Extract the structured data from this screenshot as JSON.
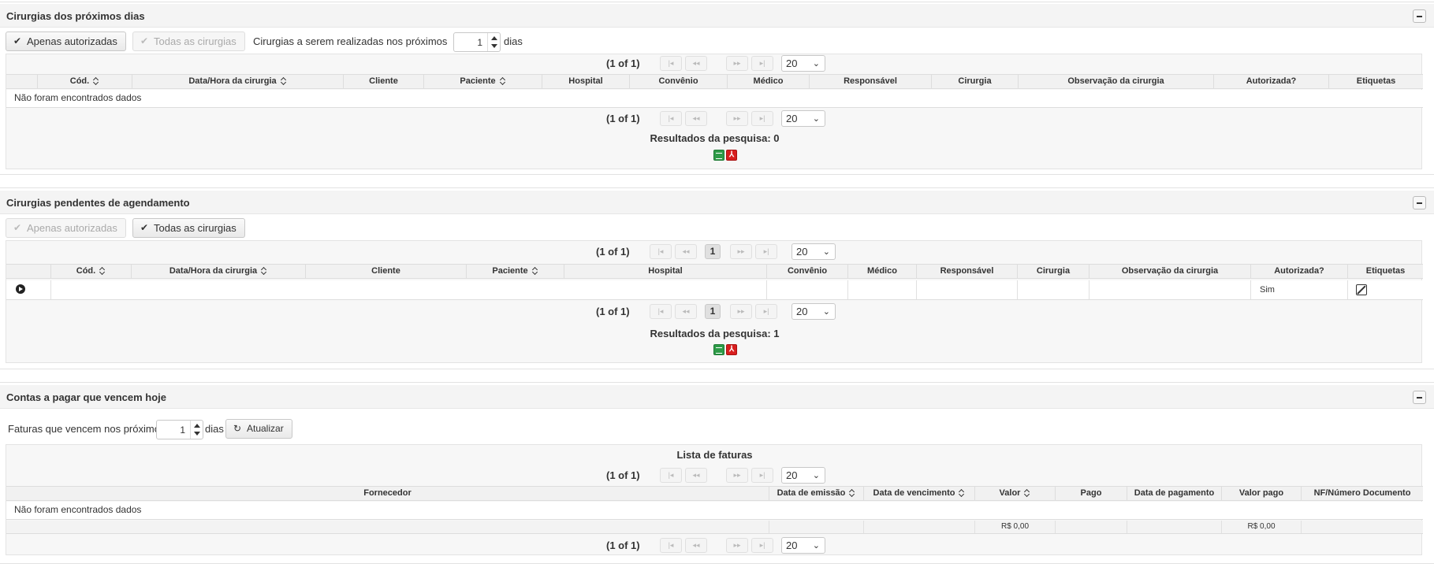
{
  "panel1": {
    "title": "Cirurgias dos próximos dias",
    "btn_authorized": "Apenas autorizadas",
    "btn_all": "Todas as cirurgias",
    "days_prefix": "Cirurgias a serem realizadas nos próximos",
    "days_value": "1",
    "days_suffix": "dias",
    "page_info": "(1 of 1)",
    "rows_per_page": "20",
    "columns": [
      "Cód.",
      "Data/Hora da cirurgia",
      "Cliente",
      "Paciente",
      "Hospital",
      "Convênio",
      "Médico",
      "Responsável",
      "Cirurgia",
      "Observação da cirurgia",
      "Autorizada?",
      "Etiquetas"
    ],
    "empty_message": "Não foram encontrados dados",
    "results": "Resultados da pesquisa: 0"
  },
  "panel2": {
    "title": "Cirurgias pendentes de agendamento",
    "btn_authorized": "Apenas autorizadas",
    "btn_all": "Todas as cirurgias",
    "page_info": "(1 of 1)",
    "current_page": "1",
    "rows_per_page": "20",
    "columns": [
      "Cód.",
      "Data/Hora da cirurgia",
      "Cliente",
      "Paciente",
      "Hospital",
      "Convênio",
      "Médico",
      "Responsável",
      "Cirurgia",
      "Observação da cirurgia",
      "Autorizada?",
      "Etiquetas"
    ],
    "row": {
      "authorized": "Sim"
    },
    "results": "Resultados da pesquisa: 1"
  },
  "panel3": {
    "title": "Contas a pagar que vencem hoje",
    "days_prefix": "Faturas que vencem nos próximos",
    "days_value": "1",
    "days_suffix": "dias",
    "refresh_label": "Atualizar",
    "list_title": "Lista de faturas",
    "page_info": "(1 of 1)",
    "rows_per_page": "20",
    "columns": [
      "Fornecedor",
      "Data de emissão",
      "Data de vencimento",
      "Valor",
      "Pago",
      "Data de pagamento",
      "Valor pago",
      "NF/Número Documento"
    ],
    "empty_message": "Não foram encontrados dados",
    "total_valor": "R$ 0,00",
    "total_valor_pago": "R$ 0,00"
  },
  "icons": {
    "check": "check-icon",
    "first": "first-page-icon",
    "prev": "prev-page-icon",
    "next": "next-page-icon",
    "last": "last-page-icon",
    "excel": "excel-export-icon",
    "pdf": "pdf-export-icon",
    "refresh": "refresh-icon"
  }
}
